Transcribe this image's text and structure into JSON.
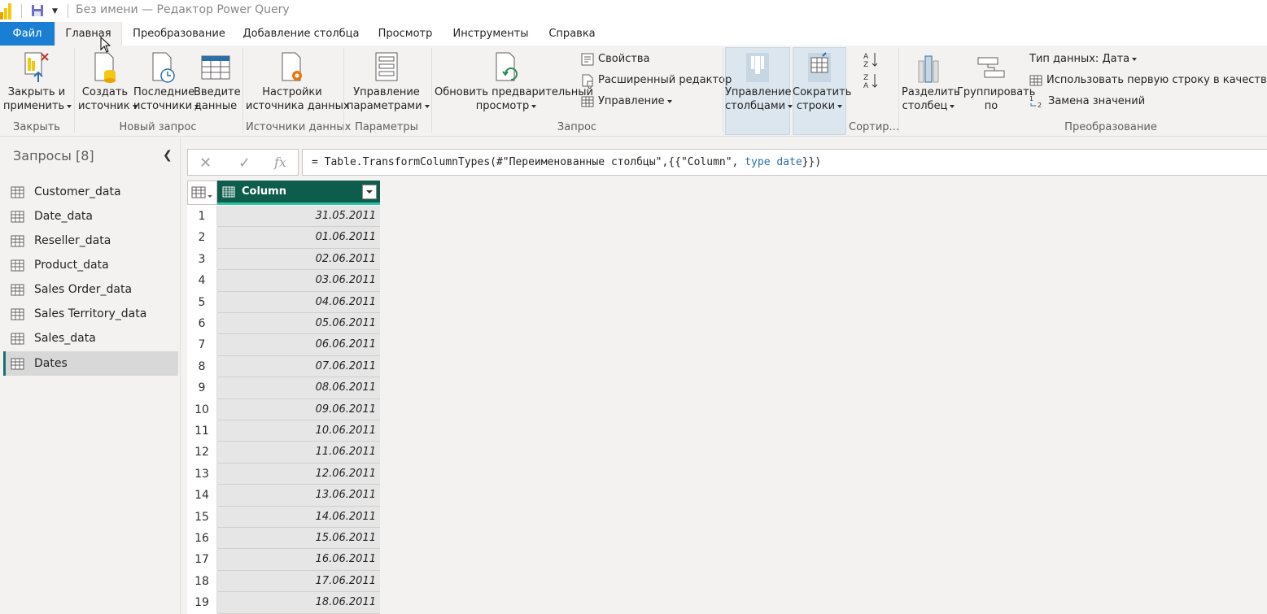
{
  "window": {
    "title": "Без имени — Редактор Power Query"
  },
  "menu_tabs": [
    "Файл",
    "Главная",
    "Преобразование",
    "Добавление столбца",
    "Просмотр",
    "Инструменты",
    "Справка"
  ],
  "ribbon": {
    "close_apply": [
      "Закрыть и",
      "применить"
    ],
    "new_source": [
      "Создать",
      "источник"
    ],
    "recent_sources": [
      "Последние",
      "источники"
    ],
    "enter_data": [
      "Введите",
      "данные"
    ],
    "data_source_settings": [
      "Настройки",
      "источника данных"
    ],
    "manage_parameters": [
      "Управление",
      "параметрами"
    ],
    "refresh_preview": [
      "Обновить предварительный",
      "просмотр"
    ],
    "properties": "Свойства",
    "advanced_editor": "Расширенный редактор",
    "manage": "Управление",
    "manage_columns": [
      "Управление",
      "столбцами"
    ],
    "reduce_rows": [
      "Сократить",
      "строки"
    ],
    "split_column": [
      "Разделить",
      "столбец"
    ],
    "group_by": [
      "Группировать",
      "по"
    ],
    "data_type": "Тип данных: Дата",
    "use_first_row": "Использовать первую строку в качестве заго",
    "replace_values": "Замена значений",
    "groups": {
      "close": "Закрыть",
      "new_query": "Новый запрос",
      "data_sources": "Источники данных",
      "parameters": "Параметры",
      "query": "Запрос",
      "sort": "Сортир...",
      "transform": "Преобразование"
    }
  },
  "queries": {
    "title": "Запросы [8]",
    "items": [
      "Customer_data",
      "Date_data",
      "Reseller_data",
      "Product_data",
      "Sales Order_data",
      "Sales Territory_data",
      "Sales_data",
      "Dates"
    ],
    "selected": "Dates"
  },
  "formula": {
    "prefix": "= Table.TransformColumnTypes(#\"Переименованные столбцы\",{{\"Column\", ",
    "kw1": "type",
    "kw2": "date",
    "suffix": "}})"
  },
  "grid": {
    "column": "Column",
    "rows": [
      {
        "n": "1",
        "v": "31.05.2011"
      },
      {
        "n": "2",
        "v": "01.06.2011"
      },
      {
        "n": "3",
        "v": "02.06.2011"
      },
      {
        "n": "4",
        "v": "03.06.2011"
      },
      {
        "n": "5",
        "v": "04.06.2011"
      },
      {
        "n": "6",
        "v": "05.06.2011"
      },
      {
        "n": "7",
        "v": "06.06.2011"
      },
      {
        "n": "8",
        "v": "07.06.2011"
      },
      {
        "n": "9",
        "v": "08.06.2011"
      },
      {
        "n": "10",
        "v": "09.06.2011"
      },
      {
        "n": "11",
        "v": "10.06.2011"
      },
      {
        "n": "12",
        "v": "11.06.2011"
      },
      {
        "n": "13",
        "v": "12.06.2011"
      },
      {
        "n": "14",
        "v": "13.06.2011"
      },
      {
        "n": "15",
        "v": "14.06.2011"
      },
      {
        "n": "16",
        "v": "15.06.2011"
      },
      {
        "n": "17",
        "v": "16.06.2011"
      },
      {
        "n": "18",
        "v": "17.06.2011"
      },
      {
        "n": "19",
        "v": "18.06.2011"
      }
    ]
  },
  "colors": {
    "file_tab": "#1a7fd4",
    "column_header": "#0e5c4c",
    "column_accent": "#2dc5a0",
    "logo": "#f2c811"
  }
}
